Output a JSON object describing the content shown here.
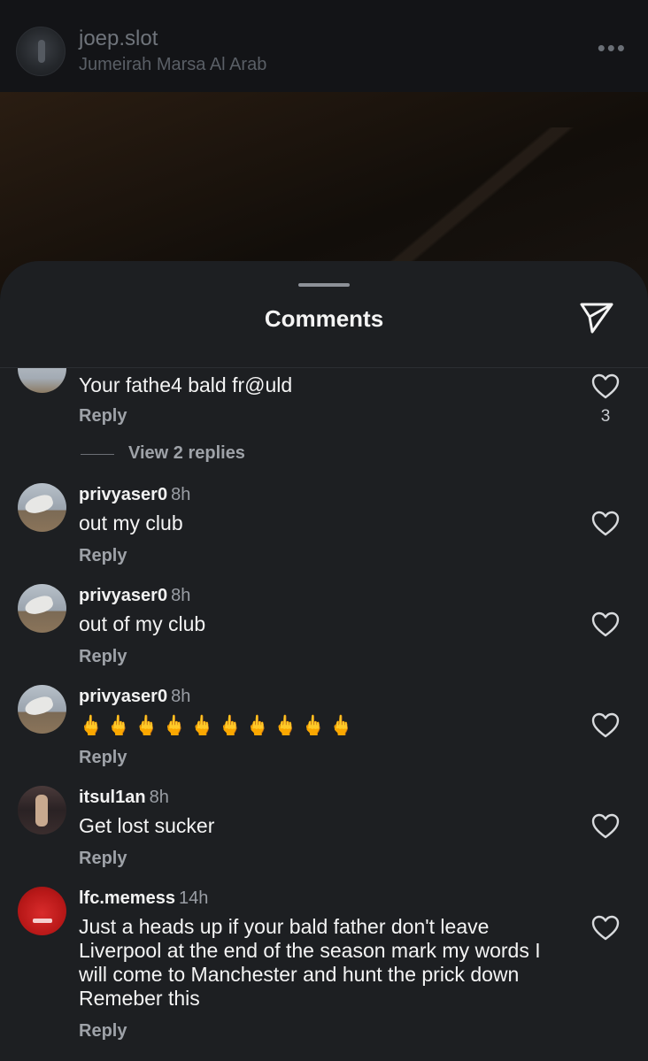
{
  "post": {
    "username": "joep.slot",
    "location": "Jumeirah Marsa Al Arab",
    "more_icon": "more-horizontal-icon"
  },
  "sheet": {
    "title": "Comments",
    "share_icon": "paper-plane-icon"
  },
  "comments": [
    {
      "username": "",
      "time": "",
      "text": "Your fathe4 bald fr@uld",
      "reply_label": "Reply",
      "likes": "3",
      "view_replies": "View 2 replies"
    },
    {
      "username": "privyaser0",
      "time": "8h",
      "text": "out my club",
      "reply_label": "Reply"
    },
    {
      "username": "privyaser0",
      "time": "8h",
      "text": "out of my club",
      "reply_label": "Reply"
    },
    {
      "username": "privyaser0",
      "time": "8h",
      "text": "🖕🖕🖕🖕🖕🖕🖕🖕🖕🖕",
      "reply_label": "Reply"
    },
    {
      "username": "itsul1an",
      "time": "8h",
      "text": "Get lost sucker",
      "reply_label": "Reply"
    },
    {
      "username": "lfc.memess",
      "time": "14h",
      "text": "Just a heads up if your bald father don't leave Liverpool at the end of the season mark my words I will come to Manchester and hunt the prick down Remeber this",
      "reply_label": "Reply"
    }
  ],
  "colors": {
    "sheet_bg": "#1d1f22",
    "text_primary": "#f4f4f4",
    "text_secondary": "#9ea2a8"
  }
}
